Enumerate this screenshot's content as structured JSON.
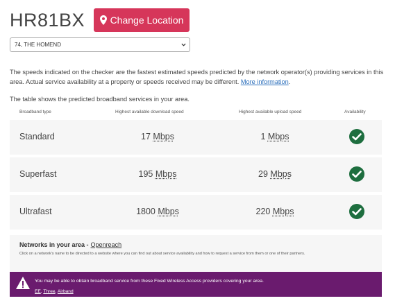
{
  "header": {
    "postcode": "HR81BX",
    "change_location_label": "Change Location"
  },
  "address_select": {
    "selected": "74, THE HOMEND"
  },
  "intro": {
    "text": "The speeds indicated on the checker are the fastest estimated speeds predicted by the network operator(s) providing services in this area. Actual service availability at a property or speeds received may be different.",
    "more_info_link": "More information",
    "period": ".",
    "table_intro": "The table shows the predicted broadband services in your area."
  },
  "table": {
    "headers": [
      "Broadband type",
      "Highest available download speed",
      "Highest available upload speed",
      "Availability"
    ],
    "rows": [
      {
        "type": "Standard",
        "download_value": "17",
        "download_unit": "Mbps",
        "upload_value": "1",
        "upload_unit": "Mbps",
        "available": true
      },
      {
        "type": "Superfast",
        "download_value": "195",
        "download_unit": "Mbps",
        "upload_value": "29",
        "upload_unit": "Mbps",
        "available": true
      },
      {
        "type": "Ultrafast",
        "download_value": "1800",
        "download_unit": "Mbps",
        "upload_value": "220",
        "upload_unit": "Mbps",
        "available": true
      }
    ]
  },
  "networks": {
    "title": "Networks in your area -",
    "network_link": "Openreach",
    "note": "Click on a network's name to be directed to a website where you can find out about service availability and how to request a service from them or one of their partners."
  },
  "fwa_banner": {
    "text": "You may be able to obtain broadband service from these Fixed Wireless Access providers covering your area.",
    "providers": [
      "EE",
      "Three",
      "Airband"
    ]
  },
  "colors": {
    "accent": "#d6365a",
    "check": "#1e6e3f",
    "banner": "#6a1b6e",
    "link": "#2a6ebb"
  },
  "icons": [
    "map-pin-icon",
    "chevron-down-icon",
    "check-circle-icon",
    "warning-icon"
  ]
}
